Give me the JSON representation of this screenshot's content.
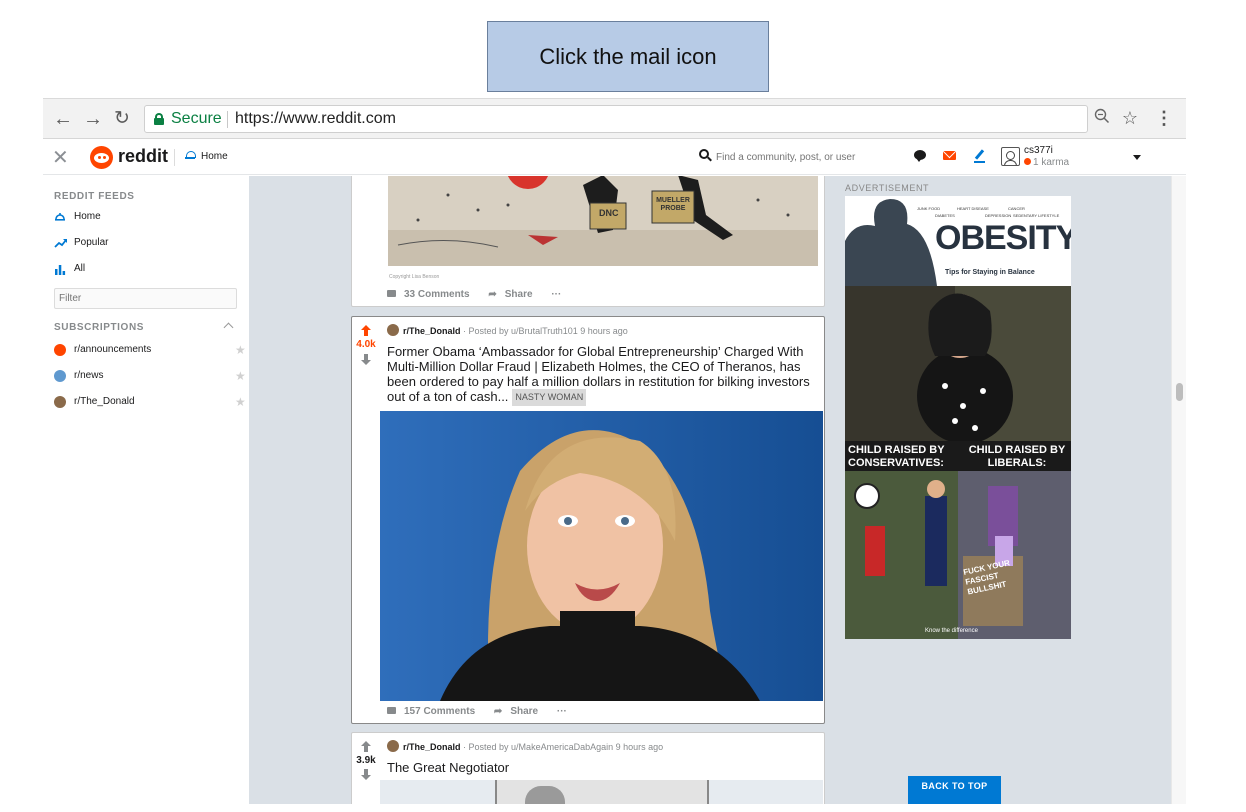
{
  "instruction": "Click the mail icon",
  "browser": {
    "secure_label": "Secure",
    "url_scheme": "https://",
    "url_host": "www.reddit.com"
  },
  "header": {
    "wordmark": "reddit",
    "home_label": "Home",
    "search_placeholder": "Find a community, post, or user",
    "username": "cs377i",
    "karma": "1 karma"
  },
  "sidebar": {
    "feeds_heading": "REDDIT FEEDS",
    "feeds": [
      {
        "label": "Home",
        "icon": "home-icon"
      },
      {
        "label": "Popular",
        "icon": "trending-icon"
      },
      {
        "label": "All",
        "icon": "bar-chart-icon"
      }
    ],
    "filter_placeholder": "Filter",
    "subscriptions_heading": "SUBSCRIPTIONS",
    "subscriptions": [
      {
        "label": "r/announcements",
        "color": "#ff4500"
      },
      {
        "label": "r/news",
        "color": "#5f99cf"
      },
      {
        "label": "r/The_Donald",
        "color": "#8a6a4a"
      }
    ]
  },
  "posts": [
    {
      "comments": "33 Comments",
      "share": "Share",
      "more": "···",
      "image_caption": "Copyright Lisa Benson",
      "cartoon_sign_left": "DNC",
      "cartoon_sign_right": "MUELLER PROBE"
    },
    {
      "votes": "4.0k",
      "subreddit": "r/The_Donald",
      "posted_by": "· Posted by u/BrutalTruth101 9 hours ago",
      "title": "Former Obama ‘Ambassador for Global Entrepreneurship’ Charged With Multi-Million Dollar Fraud | Elizabeth Holmes, the CEO of Theranos, has been ordered to pay half a million dollars in restitution for bilking investors out of a ton of cash...",
      "flair": "NASTY WOMAN",
      "comments": "157 Comments",
      "share": "Share",
      "more": "···"
    },
    {
      "votes": "3.9k",
      "subreddit": "r/The_Donald",
      "posted_by": "· Posted by u/MakeAmericaDabAgain 9 hours ago",
      "title": "The Great Negotiator"
    }
  ],
  "ad": {
    "label": "ADVERTISEMENT",
    "headline": "OBESITY",
    "tagline": "Tips for Staying in Balance",
    "topics": [
      "JUNK FOOD",
      "HEART DISEASE",
      "CANCER",
      "DIABETES",
      "DEPRESSION",
      "SEDENTARY LIFESTYLE"
    ],
    "left_caption": "CHILD RAISED BY CONSERVATIVES:",
    "right_caption": "CHILD RAISED BY LIBERALS:",
    "bottom_caption": "Know the difference",
    "sign_text": "FUCK YOUR FASCIST BULLSHIT"
  },
  "back_to_top": "BACK TO TOP",
  "colors": {
    "reddit_orange": "#ff4500",
    "reddit_blue": "#0079d3",
    "feed_bg": "#dae0e6",
    "secure_green": "#0b8043"
  }
}
